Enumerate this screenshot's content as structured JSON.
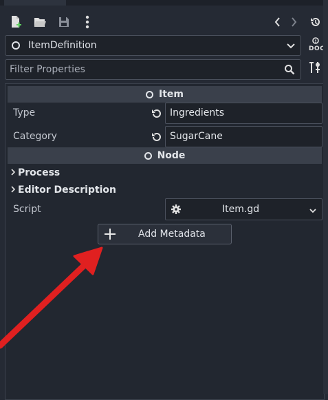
{
  "toolbar": {
    "new_icon": "new-resource-icon",
    "open_icon": "folder-open-icon",
    "save_icon": "save-icon",
    "more_icon": "more-vertical-icon",
    "back_icon": "chevron-left-icon",
    "forward_icon": "chevron-right-icon",
    "history_icon": "history-icon"
  },
  "object_selector": {
    "value": "ItemDefinition"
  },
  "doc_button": {
    "label": "DOC"
  },
  "filter": {
    "placeholder": "Filter Properties"
  },
  "sections": [
    {
      "title": "Item"
    },
    {
      "title": "Node"
    }
  ],
  "properties": [
    {
      "name": "Type",
      "value": "Ingredients"
    },
    {
      "name": "Category",
      "value": "SugarCane"
    }
  ],
  "groups": [
    {
      "label": "Process"
    },
    {
      "label": "Editor Description"
    }
  ],
  "script": {
    "name": "Script",
    "value": "Item.gd"
  },
  "add_metadata": {
    "label": "Add Metadata"
  },
  "colors": {
    "background": "#252a34",
    "section_header": "#3a404b",
    "field_bg": "#1e2229",
    "annotation_arrow": "#e02020"
  }
}
